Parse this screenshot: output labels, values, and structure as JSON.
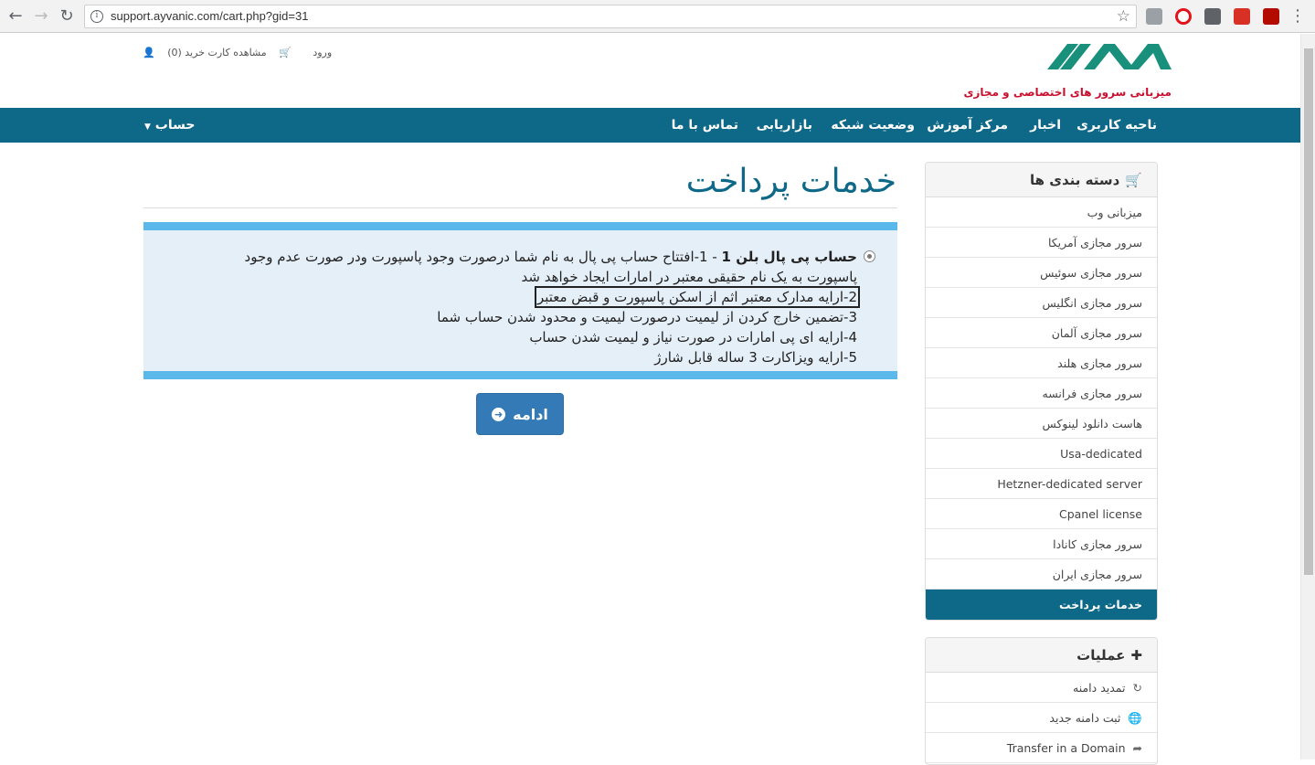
{
  "browser": {
    "url": "support.ayvanic.com/cart.php?gid=31"
  },
  "header": {
    "tagline": "میزبانی سرور های اختصاصی و مجازی",
    "cart_link": "مشاهده کارت خرید (0)",
    "login_link": "ورود",
    "brand_color": "#0e6887"
  },
  "nav": {
    "items": [
      "ناحیه کاربری",
      "اخبار",
      "مرکز آموزش",
      "وضعیت شبکه",
      "بازاریابی",
      "تماس با ما"
    ],
    "account": "حساب"
  },
  "main": {
    "title": "خدمات پرداخت",
    "product": {
      "name": "حساب پی پال بلن 1",
      "separator": " - ",
      "lines": [
        "1-افتتاح حساب پی پال به نام شما درصورت وجود پاسپورت ودر صورت عدم وجود پاسپورت به یک نام حقیقی معتبر در امارات ایجاد خواهد شد",
        "2-ارایه مدارک معتبر اثم از اسکن پاسپورت و قبض معتبر",
        "3-تضمین خارج کردن از لیمیت درصورت لیمیت و محدود شدن حساب شما",
        "4-ارایه ای پی امارات در صورت نیاز و لیمیت شدن حساب",
        "5-ارایه ویزاکارت 3 ساله قابل شارژ"
      ]
    },
    "continue_label": "ادامه"
  },
  "sidebar": {
    "categories_title": "دسته بندی ها",
    "categories": [
      "میزبانی وب",
      "سرور مجازی آمریکا",
      "سرور مجازی سوئیس",
      "سرور مجازی انگلیس",
      "سرور مجازی آلمان",
      "سرور مجازی هلند",
      "سرور مجازی فرانسه",
      "هاست دانلود لینوکس",
      "Usa-dedicated",
      "Hetzner-dedicated server",
      "Cpanel license",
      "سرور مجازی کانادا",
      "سرور مجازی ایران",
      "خدمات پرداخت"
    ],
    "actions_title": "عملیات",
    "actions": [
      {
        "label": "تمدید دامنه",
        "icon": "refresh-icon"
      },
      {
        "label": "ثبت دامنه جدید",
        "icon": "globe-icon"
      },
      {
        "label": "Transfer in a Domain",
        "icon": "share-icon"
      }
    ]
  }
}
